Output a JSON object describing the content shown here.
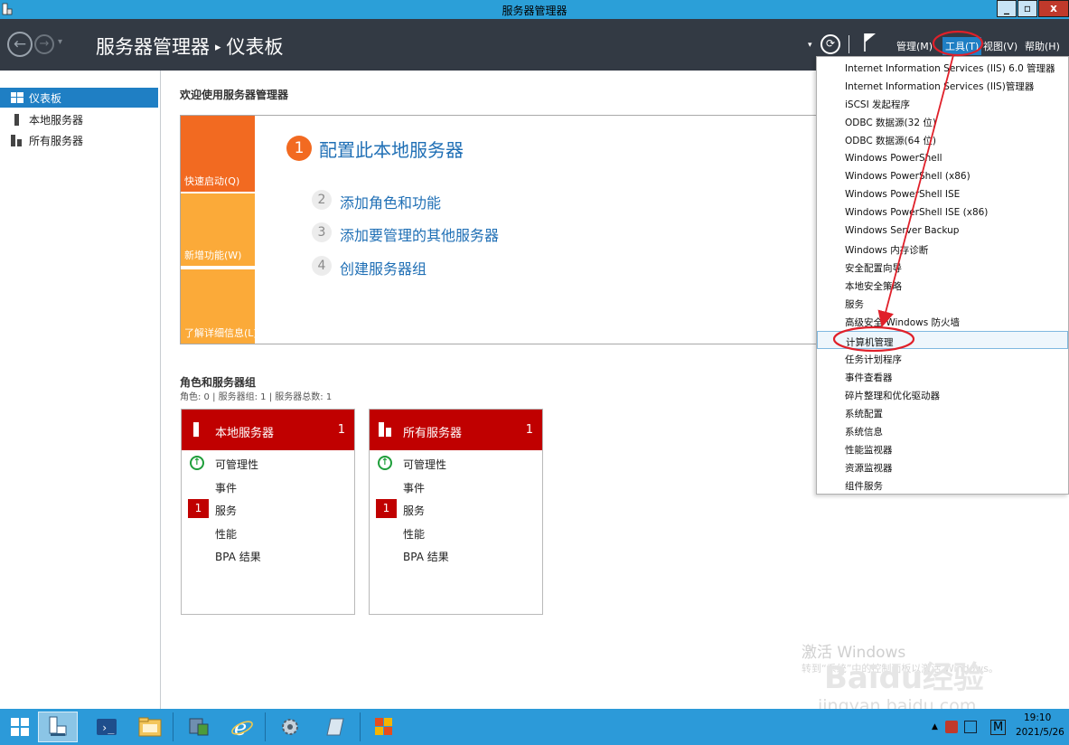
{
  "window": {
    "title": "服务器管理器",
    "min_label": "_",
    "max_label": "▫",
    "close_label": "x"
  },
  "header": {
    "breadcrumb_root": "服务器管理器",
    "breadcrumb_sep": "▸",
    "breadcrumb_current": "仪表板",
    "menus": {
      "manage": "管理(M)",
      "tools": "工具(T)",
      "view": "视图(V)",
      "help": "帮助(H)"
    }
  },
  "sidebar": {
    "items": [
      {
        "label": "仪表板",
        "icon": "dashboard-icon",
        "active": true
      },
      {
        "label": "本地服务器",
        "icon": "server-icon",
        "active": false
      },
      {
        "label": "所有服务器",
        "icon": "servers-icon",
        "active": false
      }
    ]
  },
  "main": {
    "welcome": "欢迎使用服务器管理器",
    "tiles": {
      "quick_start": "快速启动(Q)",
      "new_features": "新增功能(W)",
      "learn_more": "了解详细信息(L)"
    },
    "steps": [
      {
        "num": "1",
        "label": "配置此本地服务器"
      },
      {
        "num": "2",
        "label": "添加角色和功能"
      },
      {
        "num": "3",
        "label": "添加要管理的其他服务器"
      },
      {
        "num": "4",
        "label": "创建服务器组"
      }
    ],
    "roles_title": "角色和服务器组",
    "roles_subtitle": "角色: 0 | 服务器组: 1 | 服务器总数: 1"
  },
  "cards": [
    {
      "title": "本地服务器",
      "count": "1",
      "rows": {
        "manageability": "可管理性",
        "events": "事件",
        "services": "服务",
        "services_count": "1",
        "performance": "性能",
        "bpa": "BPA 结果"
      }
    },
    {
      "title": "所有服务器",
      "count": "1",
      "rows": {
        "manageability": "可管理性",
        "events": "事件",
        "services": "服务",
        "services_count": "1",
        "performance": "性能",
        "bpa": "BPA 结果"
      }
    }
  ],
  "tools_menu": {
    "items": [
      "Internet Information Services (IIS) 6.0 管理器",
      "Internet Information Services (IIS)管理器",
      "iSCSI 发起程序",
      "ODBC 数据源(32 位)",
      "ODBC 数据源(64 位)",
      "Windows PowerShell",
      "Windows PowerShell (x86)",
      "Windows PowerShell ISE",
      "Windows PowerShell ISE (x86)",
      "Windows Server Backup",
      "Windows 内存诊断",
      "安全配置向导",
      "本地安全策略",
      "服务",
      "高级安全 Windows 防火墙",
      "计算机管理",
      "任务计划程序",
      "事件查看器",
      "碎片整理和优化驱动器",
      "系统配置",
      "系统信息",
      "性能监视器",
      "资源监视器",
      "组件服务"
    ],
    "highlighted_item": "计算机管理"
  },
  "watermark": {
    "activate_title": "激活 Windows",
    "activate_sub": "转到“系统”中的控制面板以激活 Windows。",
    "baidu_logo": "Baidu经验",
    "baidu_url": "jingyan.baidu.com"
  },
  "taskbar": {
    "time": "19:10",
    "date": "2021/5/26",
    "tray_letter": "M"
  },
  "colors": {
    "titlebar": "#2b9fd8",
    "header": "#333a44",
    "accent_blue": "#1f7fc4",
    "orange": "#f26a21",
    "light_orange": "#fbaa39",
    "card_red": "#c00000",
    "annotation_red": "#e0202a",
    "taskbar": "#2c9ad9"
  }
}
